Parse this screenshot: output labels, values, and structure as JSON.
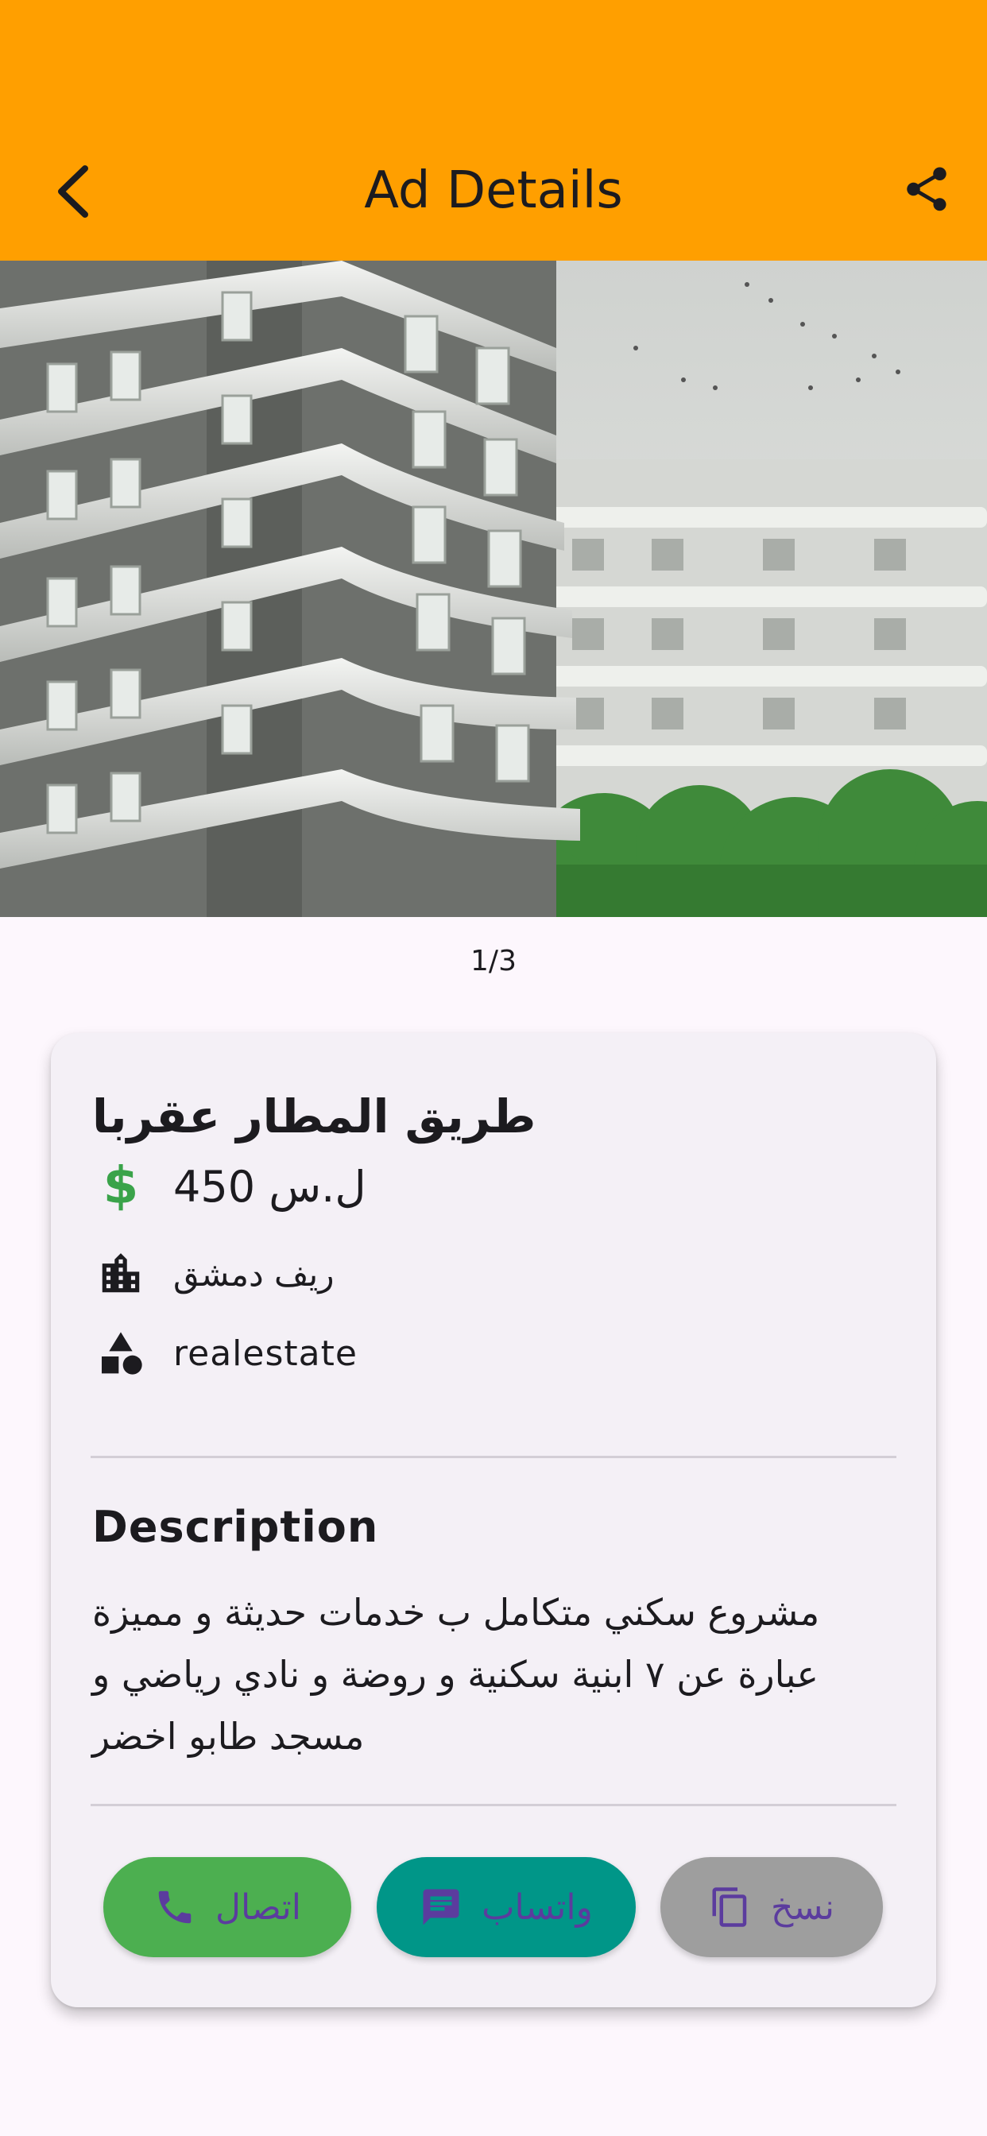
{
  "app_bar": {
    "title": "Ad Details",
    "background": "#ff9f00",
    "back_icon": "arrow-back-icon",
    "share_icon": "share-icon"
  },
  "gallery": {
    "counter": "1/3"
  },
  "ad": {
    "title": "طريق المطار عقربا",
    "price": "ل.س 450",
    "price_icon": "dollar-icon",
    "price_icon_color": "#3aa34a",
    "location": "ريف دمشق",
    "location_icon": "city-buildings-icon",
    "category": "realestate",
    "category_icon": "category-shapes-icon"
  },
  "description": {
    "heading": "Description",
    "body": "مشروع سكني متكامل ب خدمات حديثة و مميزة عبارة عن ٧ ابنية سكنية و روضة و نادي رياضي و مسجد طابو اخضر"
  },
  "actions": {
    "call_label": "اتصال",
    "call_icon": "phone-icon",
    "call_color": "#4caf50",
    "whatsapp_label": "واتساب",
    "whatsapp_icon": "chat-message-icon",
    "whatsapp_color": "#009688",
    "copy_label": "نسخ",
    "copy_icon": "copy-icon",
    "copy_color": "#9e9e9e"
  }
}
